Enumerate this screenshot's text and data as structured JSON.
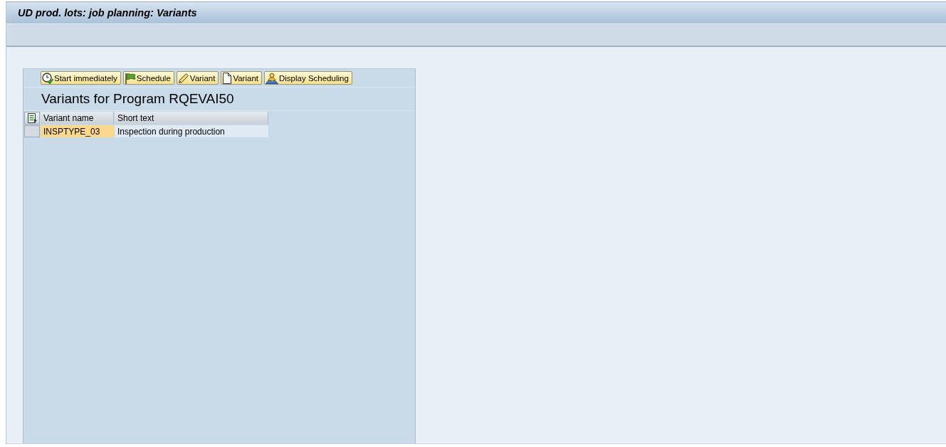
{
  "window": {
    "title": "UD prod. lots: job planning: Variants"
  },
  "toolbar": {
    "buttons": [
      "Start immediately",
      "Schedule",
      "Variant",
      "Variant",
      "Display Scheduling"
    ]
  },
  "heading": "Variants for Program RQEVAI50",
  "table": {
    "columns": [
      {
        "label": "Variant name",
        "key": true
      },
      {
        "label": "Short text",
        "key": false
      }
    ],
    "rows": [
      {
        "selected": false,
        "cells": [
          "INSPTYPE_03",
          "Inspection during production"
        ]
      }
    ]
  }
}
